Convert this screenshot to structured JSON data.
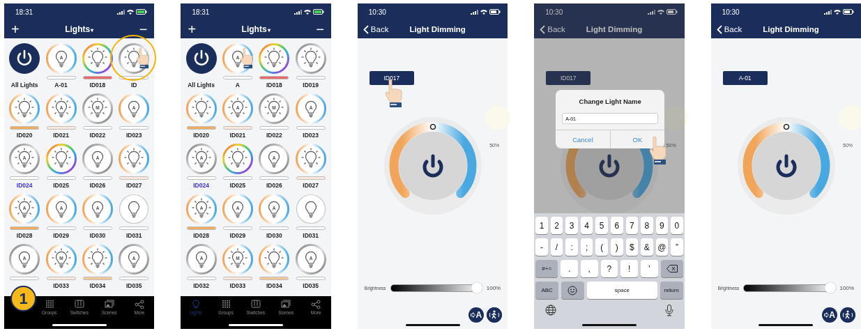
{
  "phones": [
    {
      "kind": "grid",
      "time": "18:31",
      "charging": true,
      "add": "+",
      "title": "Lights",
      "caret": "▾",
      "remove": "−",
      "step": "1",
      "tiles": [
        {
          "kind": "power",
          "label": "All Lights",
          "selected": false
        },
        {
          "kind": "cct",
          "letter": "A",
          "rays": false,
          "color": "#ffffff",
          "label": "A-01",
          "selected": false
        },
        {
          "kind": "rgb",
          "rays": true,
          "color": "#e86a6a",
          "label": "ID018",
          "selected": false
        },
        {
          "kind": "grey",
          "rays": true,
          "color": "#ffffff",
          "label": "ID",
          "selected": false,
          "tapped": true,
          "highlighted": true
        },
        {
          "kind": "cct",
          "rays": true,
          "color": "#f0ac60",
          "label": "ID020",
          "selected": false
        },
        {
          "kind": "cct",
          "letter": "A",
          "rays": true,
          "color": "#fbe8da",
          "label": "ID021",
          "selected": false
        },
        {
          "kind": "grey",
          "letter": "M",
          "rays": true,
          "color": "#ffffff",
          "label": "ID022",
          "selected": false
        },
        {
          "kind": "cct",
          "letter": "A",
          "rays": false,
          "color": "#ffffff",
          "label": "ID023",
          "selected": false
        },
        {
          "kind": "grey",
          "letter": "A",
          "rays": true,
          "color": "#ffffff",
          "label": "ID024",
          "selected": true
        },
        {
          "kind": "rgb",
          "rays": true,
          "color": "#ffffff",
          "label": "ID025",
          "selected": false
        },
        {
          "kind": "grey",
          "letter": "A",
          "rays": false,
          "color": "#ffffff",
          "label": "ID026",
          "selected": false
        },
        {
          "kind": "cct",
          "rays": true,
          "color": "#fbe8da",
          "label": "ID027",
          "selected": false
        },
        {
          "kind": "cct",
          "letter": "A",
          "rays": true,
          "color": "#f0ac60",
          "label": "ID028",
          "selected": false
        },
        {
          "kind": "cct",
          "letter": "A",
          "rays": false,
          "color": "#ffffff",
          "label": "ID029",
          "selected": false
        },
        {
          "kind": "cct",
          "letter": "A",
          "rays": false,
          "color": "#ffffff",
          "label": "ID030",
          "selected": false
        },
        {
          "kind": "thin",
          "rays": false,
          "color": "#ffffff",
          "label": "ID031",
          "selected": false
        },
        {
          "kind": "grey",
          "letter": "A",
          "rays": false,
          "color": "#ffffff"
        },
        {
          "kind": "cct",
          "letter": "M",
          "rays": true,
          "color": "#fbe8da",
          "label": "ID033",
          "selected": false
        },
        {
          "kind": "cct",
          "rays": true,
          "color": "#f2c79a",
          "label": "ID034",
          "selected": false
        },
        {
          "kind": "grey",
          "letter": "A",
          "rays": false,
          "color": "#ffffff",
          "label": "ID035",
          "selected": false
        }
      ],
      "tabs": [
        {
          "kind": "groups",
          "label": "Groups",
          "selected": false
        },
        {
          "kind": "switches",
          "label": "Switches",
          "selected": false
        },
        {
          "kind": "scenes",
          "label": "Scenes",
          "selected": false
        },
        {
          "kind": "more",
          "label": "More",
          "selected": false
        }
      ]
    },
    {
      "kind": "grid",
      "time": "18:31",
      "charging": true,
      "add": "+",
      "title": "Lights",
      "caret": "▾",
      "remove": "−",
      "tiles": [
        {
          "kind": "power",
          "label": "All Lights",
          "selected": false
        },
        {
          "kind": "cct",
          "letter": "A",
          "rays": false,
          "color": "#ffffff",
          "label": "A",
          "selected": false,
          "tapped": true
        },
        {
          "kind": "rgb",
          "rays": true,
          "color": "#e86a6a",
          "label": "ID018",
          "selected": false
        },
        {
          "kind": "grey",
          "rays": true,
          "color": "#ffffff",
          "label": "ID019",
          "selected": false
        },
        {
          "kind": "cct",
          "rays": true,
          "color": "#f0ac60",
          "label": "ID020",
          "selected": false
        },
        {
          "kind": "cct",
          "letter": "A",
          "rays": true,
          "color": "#fbe8da",
          "label": "ID021",
          "selected": false
        },
        {
          "kind": "grey",
          "letter": "M",
          "rays": true,
          "color": "#ffffff",
          "label": "ID022",
          "selected": false
        },
        {
          "kind": "cct",
          "letter": "A",
          "rays": false,
          "color": "#ffffff",
          "label": "ID023",
          "selected": false
        },
        {
          "kind": "grey",
          "letter": "A",
          "rays": true,
          "color": "#ffffff",
          "label": "ID024",
          "selected": true
        },
        {
          "kind": "rgb",
          "rays": true,
          "color": "#ffffff",
          "label": "ID025",
          "selected": false
        },
        {
          "kind": "grey",
          "letter": "A",
          "rays": false,
          "color": "#ffffff",
          "label": "ID026",
          "selected": false
        },
        {
          "kind": "cct",
          "rays": true,
          "color": "#fbe8da",
          "label": "ID027",
          "selected": false
        },
        {
          "kind": "cct",
          "letter": "A",
          "rays": true,
          "color": "#f0ac60",
          "label": "ID028",
          "selected": false
        },
        {
          "kind": "cct",
          "letter": "A",
          "rays": false,
          "color": "#ffffff",
          "label": "ID029",
          "selected": false
        },
        {
          "kind": "cct",
          "letter": "A",
          "rays": false,
          "color": "#ffffff",
          "label": "ID030",
          "selected": false
        },
        {
          "kind": "thin",
          "rays": false,
          "color": "#ffffff",
          "label": "ID031",
          "selected": false
        },
        {
          "kind": "grey",
          "letter": "A",
          "rays": false,
          "color": "#ffffff",
          "label": "ID032",
          "selected": false
        },
        {
          "kind": "cct",
          "letter": "M",
          "rays": true,
          "color": "#fbe8da",
          "label": "ID033",
          "selected": false
        },
        {
          "kind": "cct",
          "rays": true,
          "color": "#f2c79a",
          "label": "ID034",
          "selected": false
        },
        {
          "kind": "grey",
          "letter": "A",
          "rays": false,
          "color": "#ffffff",
          "label": "ID035",
          "selected": false
        }
      ],
      "tabs": [
        {
          "kind": "bulb",
          "label": "Lights",
          "selected": true
        },
        {
          "kind": "groups",
          "label": "Groups",
          "selected": false
        },
        {
          "kind": "switches",
          "label": "Switches",
          "selected": false
        },
        {
          "kind": "scenes",
          "label": "Scenes",
          "selected": false
        },
        {
          "kind": "more",
          "label": "More",
          "selected": false
        }
      ]
    },
    {
      "kind": "dimmer",
      "time": "10:30",
      "charging": false,
      "back": "Back",
      "title": "Light Dimming",
      "name": {
        "label": "ID017",
        "tapped": true
      },
      "percent": "50%",
      "brightness": {
        "label": "Brightness",
        "level": 1,
        "reading": "100%"
      },
      "auto": "A"
    },
    {
      "kind": "dimmer",
      "time": "10:30",
      "charging": false,
      "dimmed": true,
      "back": "Back",
      "title": "Light Dimming",
      "name": {
        "label": "ID017",
        "tapped": false
      },
      "percent": "50%",
      "dialog": {
        "title": "Change Light Name",
        "value": "A-01",
        "cancel": "Cancel",
        "ok": "OK",
        "ok_tapped": true
      },
      "keyboard": [
        [
          {
            "kind": "char",
            "label": "1"
          },
          {
            "kind": "char",
            "label": "2"
          },
          {
            "kind": "char",
            "label": "3"
          },
          {
            "kind": "char",
            "label": "4"
          },
          {
            "kind": "char",
            "label": "5"
          },
          {
            "kind": "char",
            "label": "6"
          },
          {
            "kind": "char",
            "label": "7"
          },
          {
            "kind": "char",
            "label": "8"
          },
          {
            "kind": "char",
            "label": "9"
          },
          {
            "kind": "char",
            "label": "0"
          }
        ],
        [
          {
            "kind": "char",
            "label": "-"
          },
          {
            "kind": "char",
            "label": "/"
          },
          {
            "kind": "char",
            "label": ":"
          },
          {
            "kind": "char",
            "label": ";"
          },
          {
            "kind": "char",
            "label": "("
          },
          {
            "kind": "char",
            "label": ")"
          },
          {
            "kind": "char",
            "label": "$"
          },
          {
            "kind": "char",
            "label": "&"
          },
          {
            "kind": "char",
            "label": "@"
          },
          {
            "kind": "char",
            "label": "”"
          }
        ],
        [
          {
            "kind": "function",
            "label": "#+="
          },
          {
            "kind": "char",
            "label": "."
          },
          {
            "kind": "char",
            "label": ","
          },
          {
            "kind": "char",
            "label": "?"
          },
          {
            "kind": "char",
            "label": "!"
          },
          {
            "kind": "char",
            "label": "’"
          },
          {
            "kind": "backspace"
          }
        ],
        [
          {
            "kind": "function",
            "label": "ABC"
          },
          {
            "kind": "emoji"
          },
          {
            "kind": "space",
            "label": "space"
          },
          {
            "kind": "function",
            "label": "return"
          }
        ],
        [
          {
            "kind": "globe"
          },
          {
            "kind": "mic"
          }
        ]
      ]
    },
    {
      "kind": "dimmer",
      "time": "10:30",
      "charging": false,
      "back": "Back",
      "title": "Light Dimming",
      "name": {
        "label": "A-01",
        "tapped": false
      },
      "percent": "50%",
      "brightness": {
        "label": "Brightness",
        "level": 1,
        "reading": "100%"
      },
      "auto": "A"
    }
  ]
}
